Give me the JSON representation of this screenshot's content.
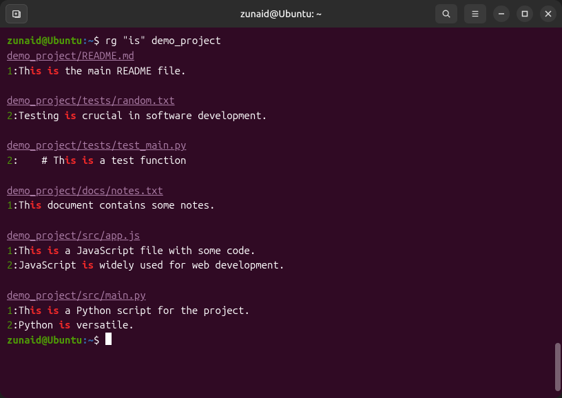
{
  "titlebar": {
    "title": "zunaid@Ubuntu: ~"
  },
  "prompt": {
    "user_host": "zunaid@Ubuntu",
    "path": "~",
    "separator": ":",
    "symbol": "$"
  },
  "command": "rg \"is\" demo_project",
  "results": [
    {
      "file": "demo_project/README.md",
      "lines": [
        {
          "num": "1",
          "parts": [
            {
              "t": ":Th",
              "c": "txt"
            },
            {
              "t": "is",
              "c": "match"
            },
            {
              "t": " ",
              "c": "txt"
            },
            {
              "t": "is",
              "c": "match"
            },
            {
              "t": " the main README file.",
              "c": "txt"
            }
          ]
        }
      ]
    },
    {
      "file": "demo_project/tests/random.txt",
      "lines": [
        {
          "num": "2",
          "parts": [
            {
              "t": ":Testing ",
              "c": "txt"
            },
            {
              "t": "is",
              "c": "match"
            },
            {
              "t": " crucial in software development.",
              "c": "txt"
            }
          ]
        }
      ]
    },
    {
      "file": "demo_project/tests/test_main.py",
      "lines": [
        {
          "num": "2",
          "parts": [
            {
              "t": ":    # Th",
              "c": "txt"
            },
            {
              "t": "is",
              "c": "match"
            },
            {
              "t": " ",
              "c": "txt"
            },
            {
              "t": "is",
              "c": "match"
            },
            {
              "t": " a test function",
              "c": "txt"
            }
          ]
        }
      ]
    },
    {
      "file": "demo_project/docs/notes.txt",
      "lines": [
        {
          "num": "1",
          "parts": [
            {
              "t": ":Th",
              "c": "txt"
            },
            {
              "t": "is",
              "c": "match"
            },
            {
              "t": " document contains some notes.",
              "c": "txt"
            }
          ]
        }
      ]
    },
    {
      "file": "demo_project/src/app.js",
      "lines": [
        {
          "num": "1",
          "parts": [
            {
              "t": ":Th",
              "c": "txt"
            },
            {
              "t": "is",
              "c": "match"
            },
            {
              "t": " ",
              "c": "txt"
            },
            {
              "t": "is",
              "c": "match"
            },
            {
              "t": " a JavaScript file with some code.",
              "c": "txt"
            }
          ]
        },
        {
          "num": "2",
          "parts": [
            {
              "t": ":JavaScript ",
              "c": "txt"
            },
            {
              "t": "is",
              "c": "match"
            },
            {
              "t": " widely used for web development.",
              "c": "txt"
            }
          ]
        }
      ]
    },
    {
      "file": "demo_project/src/main.py",
      "lines": [
        {
          "num": "1",
          "parts": [
            {
              "t": ":Th",
              "c": "txt"
            },
            {
              "t": "is",
              "c": "match"
            },
            {
              "t": " ",
              "c": "txt"
            },
            {
              "t": "is",
              "c": "match"
            },
            {
              "t": " a Python script for the project.",
              "c": "txt"
            }
          ]
        },
        {
          "num": "2",
          "parts": [
            {
              "t": ":Python ",
              "c": "txt"
            },
            {
              "t": "is",
              "c": "match"
            },
            {
              "t": " versatile.",
              "c": "txt"
            }
          ]
        }
      ]
    }
  ]
}
